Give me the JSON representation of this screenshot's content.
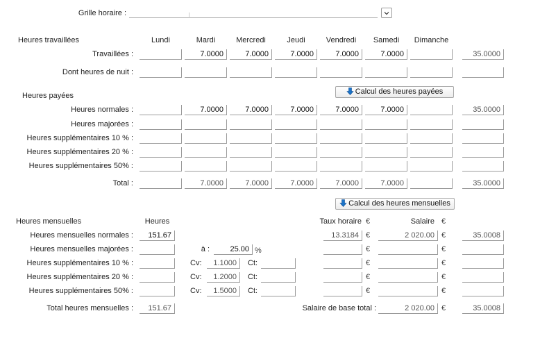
{
  "grille": {
    "label": "Grille horaire :",
    "value": ""
  },
  "days": [
    "Lundi",
    "Mardi",
    "Mercredi",
    "Jeudi",
    "Vendredi",
    "Samedi",
    "Dimanche"
  ],
  "travaillees": {
    "section": "Heures travaillées",
    "rows": [
      {
        "label": "Travaillées :",
        "values": [
          "",
          "7.0000",
          "7.0000",
          "7.0000",
          "7.0000",
          "7.0000",
          ""
        ],
        "total": "35.0000"
      },
      {
        "label": "Dont heures de nuit :",
        "values": [
          "",
          "",
          "",
          "",
          "",
          "",
          ""
        ],
        "total": ""
      }
    ]
  },
  "payees": {
    "section": "Heures payées",
    "button": "Calcul des heures payées",
    "rows": [
      {
        "label": "Heures normales :",
        "values": [
          "",
          "7.0000",
          "7.0000",
          "7.0000",
          "7.0000",
          "7.0000",
          ""
        ],
        "total": "35.0000"
      },
      {
        "label": "Heures majorées :",
        "values": [
          "",
          "",
          "",
          "",
          "",
          "",
          ""
        ],
        "total": ""
      },
      {
        "label": "Heures supplémentaires 10 % :",
        "values": [
          "",
          "",
          "",
          "",
          "",
          "",
          ""
        ],
        "total": ""
      },
      {
        "label": "Heures supplémentaires 20 % :",
        "values": [
          "",
          "",
          "",
          "",
          "",
          "",
          ""
        ],
        "total": ""
      },
      {
        "label": "Heures supplémentaires 50% :",
        "values": [
          "",
          "",
          "",
          "",
          "",
          "",
          ""
        ],
        "total": ""
      },
      {
        "label": "Total :",
        "values": [
          "",
          "7.0000",
          "7.0000",
          "7.0000",
          "7.0000",
          "7.0000",
          ""
        ],
        "total": "35.0000"
      }
    ]
  },
  "mensuelles": {
    "section": "Heures mensuelles",
    "button": "Calcul des heures mensuelles",
    "col_heures": "Heures",
    "col_taux": "Taux horaire",
    "col_salaire": "Salaire",
    "currency": "€",
    "a_label": "à :",
    "a_value": "25.00",
    "percent": "%",
    "cv_label": "Cv:",
    "ct_label": "Ct:",
    "rows": [
      {
        "label": "Heures mensuelles normales :",
        "heures": "151.67",
        "cv": "",
        "ct": "",
        "taux": "13.3184",
        "salaire": "2 020.00",
        "total": "35.0008"
      },
      {
        "label": "Heures mensuelles majorées :",
        "heures": "",
        "cv": "",
        "ct": "",
        "taux": "",
        "salaire": "",
        "total": ""
      },
      {
        "label": "Heures supplémentaires 10 % :",
        "heures": "",
        "cv": "1.1000",
        "ct": "",
        "taux": "",
        "salaire": "",
        "total": ""
      },
      {
        "label": "Heures supplémentaires 20 % :",
        "heures": "",
        "cv": "1.2000",
        "ct": "",
        "taux": "",
        "salaire": "",
        "total": ""
      },
      {
        "label": "Heures supplémentaires 50% :",
        "heures": "",
        "cv": "1.5000",
        "ct": "",
        "taux": "",
        "salaire": "",
        "total": ""
      }
    ],
    "total_label": "Total heures mensuelles :",
    "total_heures": "151.67",
    "salaire_base_label": "Salaire de base total :",
    "salaire_base": "2 020.00",
    "salaire_base_total": "35.0008"
  }
}
